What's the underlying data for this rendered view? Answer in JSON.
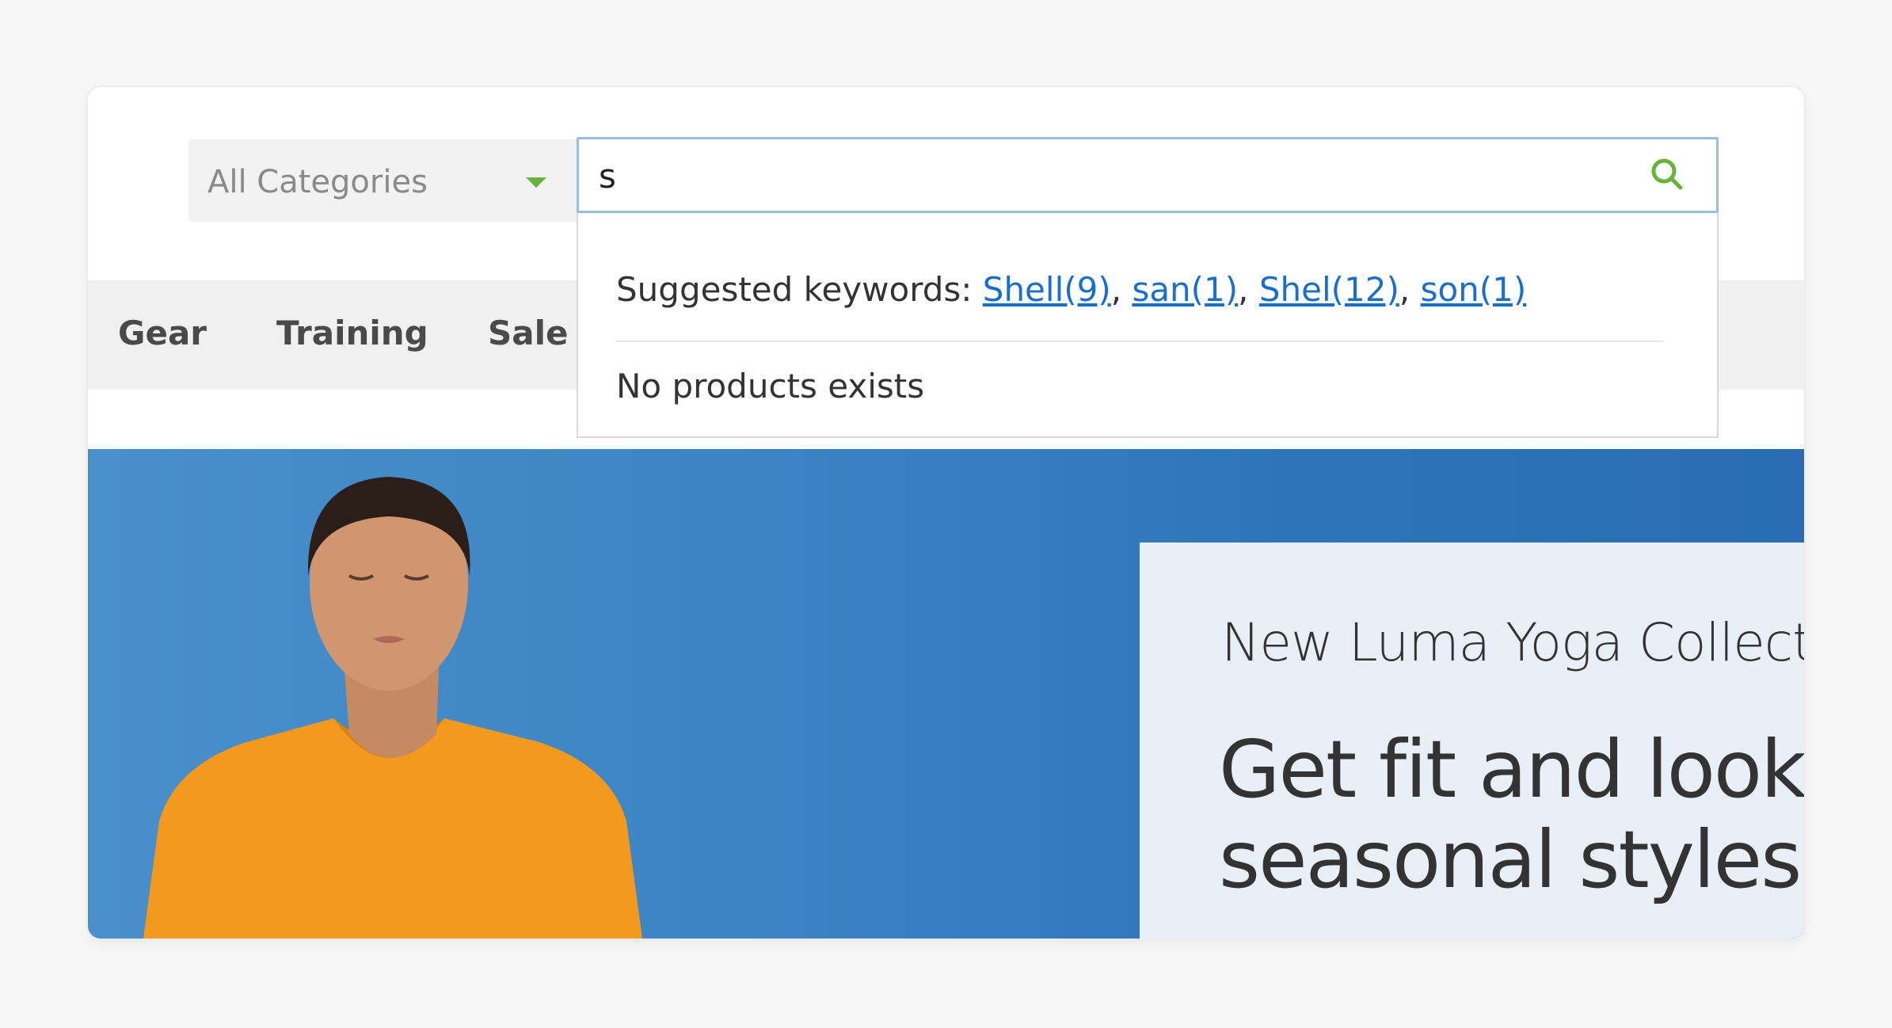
{
  "search": {
    "category_label": "All Categories",
    "query": "s"
  },
  "nav": {
    "items": [
      {
        "label": "Gear"
      },
      {
        "label": "Training"
      },
      {
        "label": "Sale"
      }
    ]
  },
  "suggestions": {
    "prefix": "Suggested keywords: ",
    "keywords": [
      {
        "label": "Shell(9)"
      },
      {
        "label": "san(1)"
      },
      {
        "label": "Shel(12)"
      },
      {
        "label": "son(1)"
      }
    ],
    "separator": ", ",
    "empty_message": "No products exists"
  },
  "hero": {
    "subtitle": "New Luma Yoga Collection",
    "title_line1": "Get fit and look fab in new",
    "title_line2": "seasonal styles"
  },
  "colors": {
    "accent_green": "#66b43a",
    "link_blue": "#1a6fc9",
    "hero_blue": "#3c83c4"
  }
}
